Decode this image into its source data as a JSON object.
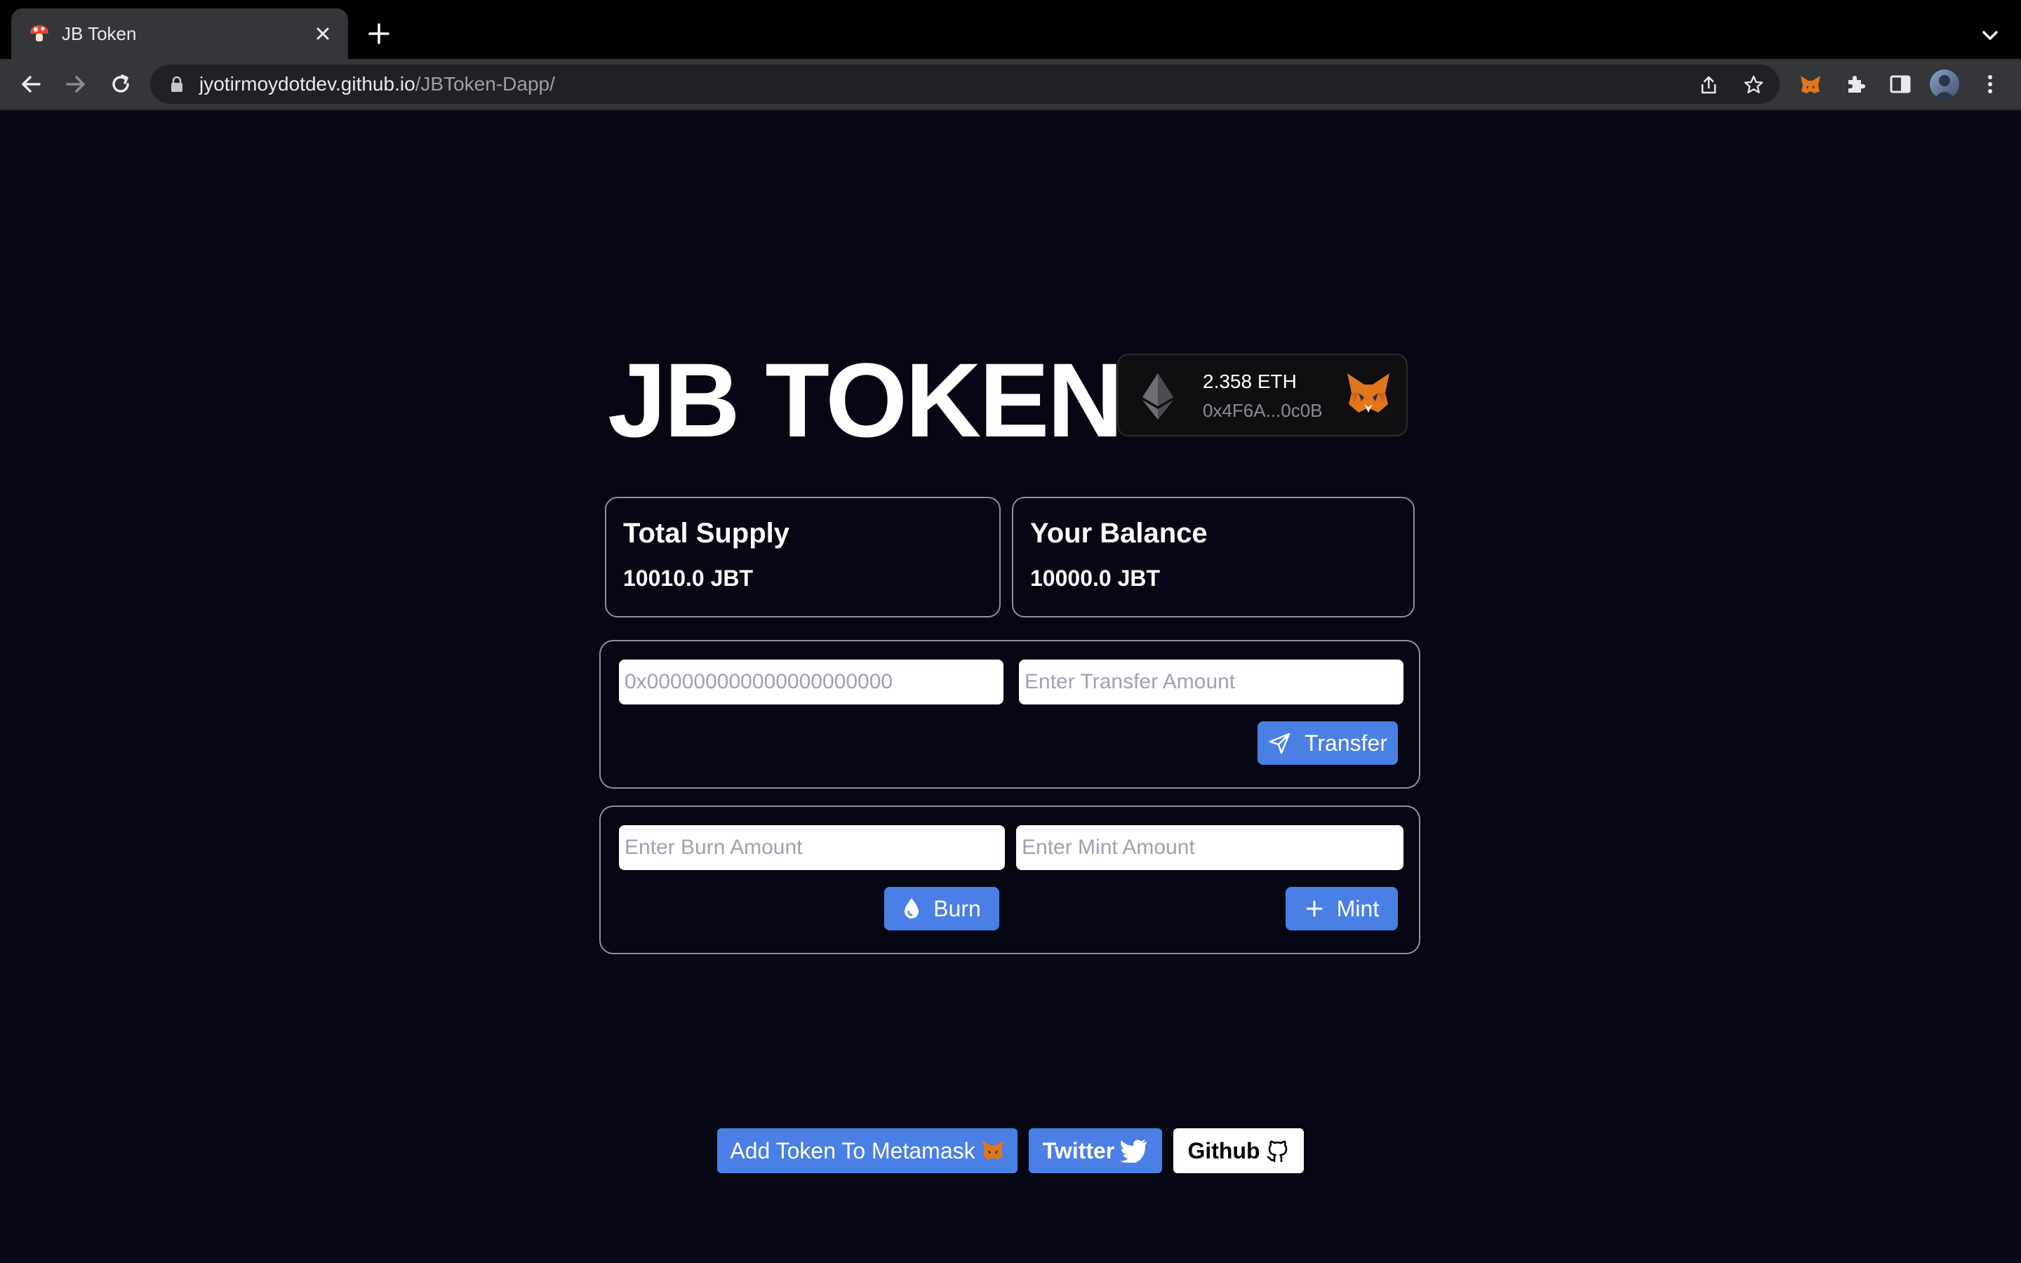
{
  "browser": {
    "tab_title": "JB Token",
    "url_host": "jyotirmoydotdev.github.io",
    "url_path": "/JBToken-Dapp/"
  },
  "header": {
    "title": "JB TOKEN",
    "wallet": {
      "balance": "2.358 ETH",
      "address": "0x4F6A...0c0B"
    }
  },
  "stats": {
    "total_supply": {
      "label": "Total Supply",
      "value": "10010.0 JBT"
    },
    "your_balance": {
      "label": "Your Balance",
      "value": "10000.0 JBT"
    }
  },
  "transfer": {
    "address_placeholder": "0x000000000000000000000",
    "amount_placeholder": "Enter Transfer Amount",
    "button_label": "Transfer"
  },
  "burn_mint": {
    "burn_placeholder": "Enter Burn Amount",
    "mint_placeholder": "Enter Mint Amount",
    "burn_label": "Burn",
    "mint_label": "Mint"
  },
  "footer": {
    "add_token_label": "Add Token To Metamask",
    "twitter_label": "Twitter",
    "github_label": "Github"
  },
  "colors": {
    "background": "#050814",
    "accent": "#4a7fe6"
  }
}
